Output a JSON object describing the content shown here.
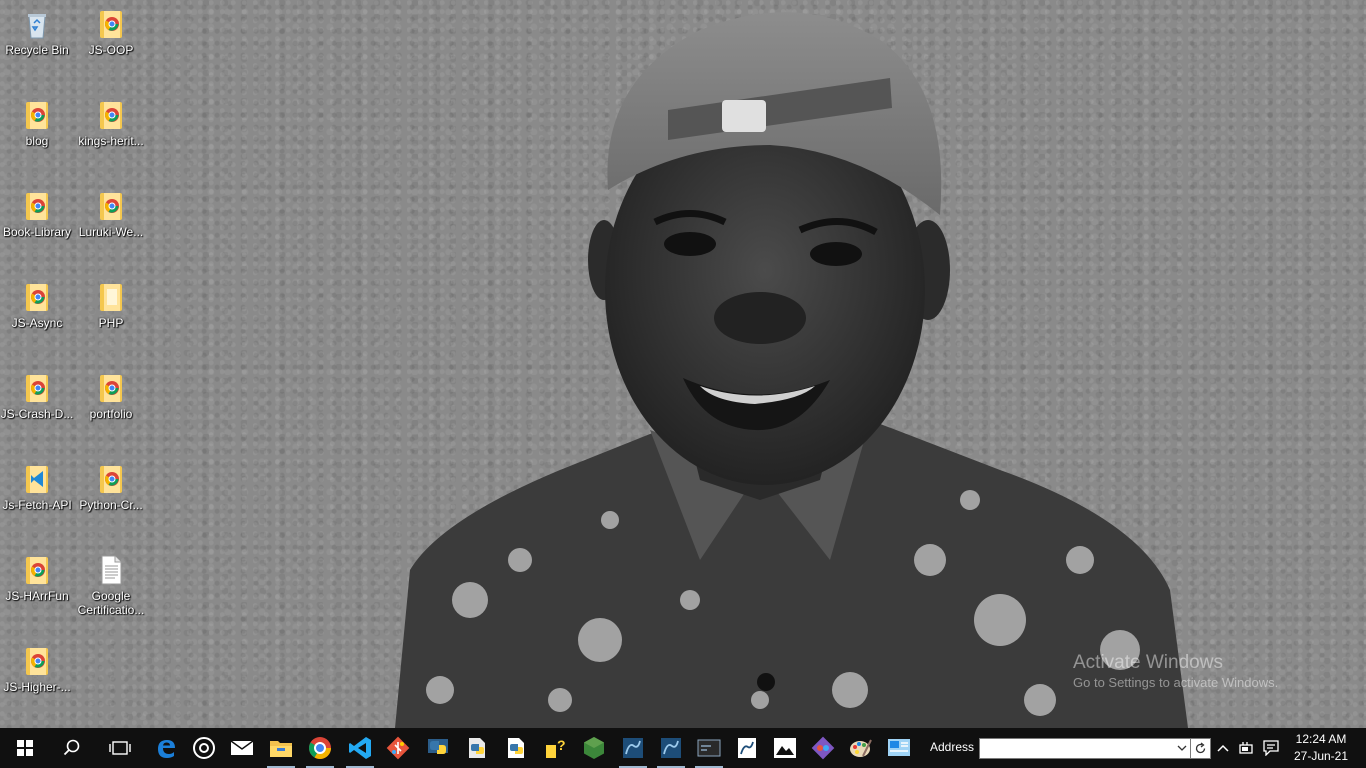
{
  "desktop": {
    "icons": [
      {
        "label": "Recycle Bin",
        "icon": "recycle-bin-icon"
      },
      {
        "label": "JS-OOP",
        "icon": "chrome-folder-icon"
      },
      {
        "label": "blog",
        "icon": "chrome-folder-icon"
      },
      {
        "label": "kings-herit...",
        "icon": "chrome-folder-icon"
      },
      {
        "label": "Book-Library",
        "icon": "chrome-folder-icon"
      },
      {
        "label": "Luruki-We...",
        "icon": "chrome-folder-icon"
      },
      {
        "label": "JS-Async",
        "icon": "chrome-folder-icon"
      },
      {
        "label": "PHP",
        "icon": "folder-icon"
      },
      {
        "label": "JS-Crash-D...",
        "icon": "chrome-folder-icon"
      },
      {
        "label": "portfolio",
        "icon": "chrome-folder-icon"
      },
      {
        "label": "Js-Fetch-API",
        "icon": "vscode-folder-icon"
      },
      {
        "label": "Python-Cr...",
        "icon": "chrome-folder-icon"
      },
      {
        "label": "JS-HArrFun",
        "icon": "chrome-folder-icon"
      },
      {
        "label": "Google Certificatio...",
        "icon": "document-icon"
      },
      {
        "label": "JS-Higher-...",
        "icon": "chrome-folder-icon"
      }
    ],
    "watermark": {
      "title": "Activate Windows",
      "subtitle": "Go to Settings to activate Windows."
    }
  },
  "taskbar": {
    "apps": [
      {
        "name": "start",
        "icon": "windows-start-icon"
      },
      {
        "name": "search",
        "icon": "search-icon"
      },
      {
        "name": "task-view",
        "icon": "task-view-icon"
      },
      {
        "name": "edge",
        "icon": "edge-icon"
      },
      {
        "name": "groove",
        "icon": "groove-music-icon"
      },
      {
        "name": "mail",
        "icon": "mail-icon"
      },
      {
        "name": "file-explorer",
        "icon": "file-explorer-icon"
      },
      {
        "name": "chrome",
        "icon": "chrome-icon"
      },
      {
        "name": "vscode",
        "icon": "vscode-icon"
      },
      {
        "name": "git",
        "icon": "git-icon"
      },
      {
        "name": "python-idle",
        "icon": "python-icon"
      },
      {
        "name": "python-launcher",
        "icon": "python-file-icon"
      },
      {
        "name": "python-docs",
        "icon": "python-doc-icon"
      },
      {
        "name": "help",
        "icon": "help-icon"
      },
      {
        "name": "nodejs",
        "icon": "nodejs-icon"
      },
      {
        "name": "workbench",
        "icon": "mysql-workbench-icon"
      },
      {
        "name": "workbench-2",
        "icon": "mysql-workbench-icon"
      },
      {
        "name": "mysql-shell",
        "icon": "mysql-shell-icon"
      },
      {
        "name": "sql-doc",
        "icon": "sql-doc-icon"
      },
      {
        "name": "photos",
        "icon": "photos-icon"
      },
      {
        "name": "git-gui",
        "icon": "git-gui-icon"
      },
      {
        "name": "paint",
        "icon": "paint-icon"
      },
      {
        "name": "control-panel",
        "icon": "control-panel-icon"
      }
    ],
    "address": {
      "label": "Address",
      "value": ""
    },
    "tray": {
      "time": "12:24 AM",
      "date": "27-Jun-21"
    }
  }
}
